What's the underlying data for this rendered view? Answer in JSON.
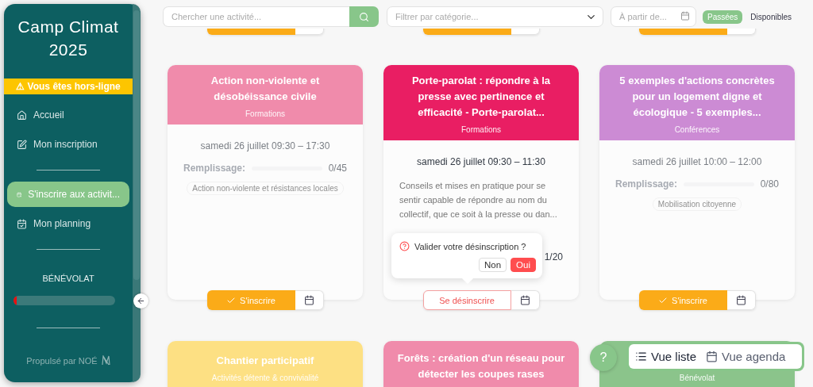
{
  "sidebar": {
    "title": "Camp Climat 2025",
    "offline_banner": "⚠ Vous êtes hors-ligne",
    "nav_groups": [
      [
        {
          "label": "Accueil",
          "selected": false
        },
        {
          "label": "Mon inscription",
          "selected": false
        }
      ],
      [
        {
          "label": "S'inscrire aux activit...",
          "selected": true
        },
        {
          "label": "Mon planning",
          "selected": false
        }
      ]
    ],
    "volunteer": {
      "heading": "BÉNÉVOLAT",
      "level": 0.03
    },
    "footer": "Propulsé par NOÉ"
  },
  "toolbar": {
    "search": {
      "placeholder": "Chercher une activité..."
    },
    "category": {
      "placeholder": "Filtrer par catégorie..."
    },
    "date": {
      "placeholder": "À partir de..."
    },
    "toggles": [
      {
        "label": "Passées",
        "selected": true
      },
      {
        "label": "Disponibles",
        "selected": false
      }
    ]
  },
  "previous_row": [
    {
      "registered": false
    },
    {
      "registered": false
    },
    {
      "registered": false
    }
  ],
  "cards": [
    {
      "title": "Action non-violente et désobéissance civile",
      "category": "Formations",
      "color": "#f08bab",
      "faded": true,
      "date": "samedi 26 juillet 09:30 – 17:30",
      "filling": {
        "label": "Remplissage:",
        "level": 0,
        "reading": "0/45"
      },
      "tags": [
        "Action non-violente et résistances locales"
      ],
      "register": {
        "label": "S'inscrire",
        "registered": false
      }
    },
    {
      "title": "Porte-parolat : répondre à la presse avec pertinence et efficacité - Porte-parolat...",
      "category": "Formations",
      "color": "#e91e63",
      "faded": false,
      "date": "samedi 26 juillet 09:30 – 11:30",
      "description": "Conseils et mises en pratique pour se sentir capable de répondre au nom du collectif, que ce soit à la presse ou dan...",
      "filling": {
        "reading": "1/20"
      },
      "register": {
        "label": "Se désinscrire",
        "registered": true
      },
      "popover": {
        "question": "Valider votre désinscription ?",
        "buttons": [
          {
            "label": "Non",
            "kind": "cancel"
          },
          {
            "label": "Oui",
            "kind": "confirm"
          }
        ]
      }
    },
    {
      "title": "5 exemples d'actions concrètes pour un logement digne et écologique - 5 exemples...",
      "category": "Conférences",
      "color": "#cc8bd4",
      "faded": true,
      "date": "samedi 26 juillet 10:00 – 12:00",
      "filling": {
        "label": "Remplissage:",
        "level": 0,
        "reading": "0/80"
      },
      "tags": [
        "Mobilisation citoyenne"
      ],
      "register": {
        "label": "S'inscrire",
        "registered": false
      }
    },
    {
      "title": "Chantier participatif",
      "category": "Activités détente & convivialité",
      "color": "#fde083"
    },
    {
      "title": "Forêts : création d'un réseau pour détecter les coupes rases",
      "color": "#f08bab"
    },
    {
      "category": "Bénévolat",
      "color": "#8bc48b"
    }
  ],
  "help_button": "?",
  "views": [
    {
      "label": "Vue liste",
      "selected": true
    },
    {
      "label": "Vue agenda",
      "selected": false
    }
  ]
}
